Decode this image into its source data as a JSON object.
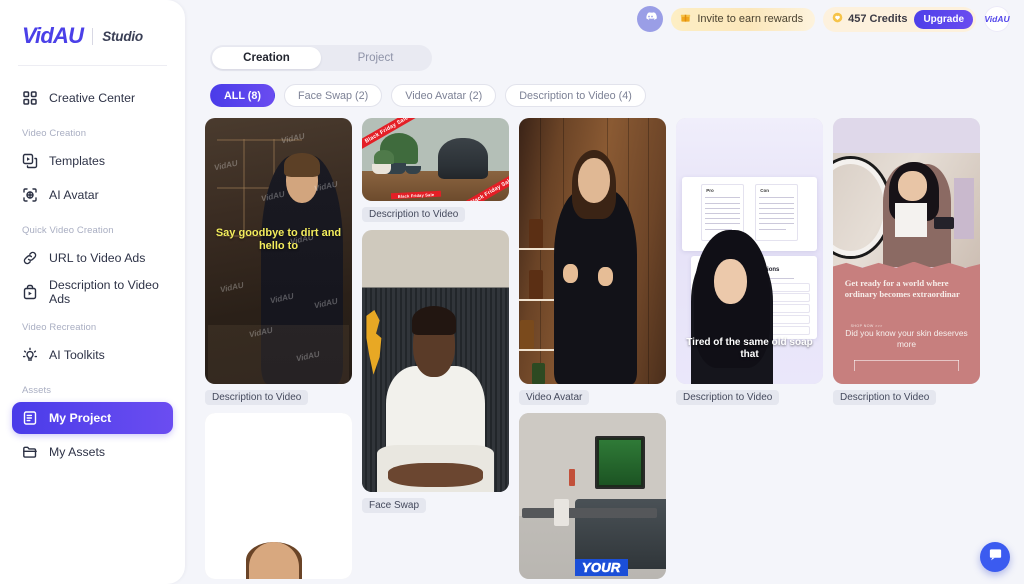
{
  "brand": {
    "name": "VidAU",
    "sub": "Studio"
  },
  "sidebar": {
    "top_items": [
      {
        "label": "Creative Center",
        "icon": "grid-icon"
      }
    ],
    "groups": [
      {
        "label": "Video Creation",
        "items": [
          {
            "label": "Templates",
            "icon": "templates-icon"
          },
          {
            "label": "AI Avatar",
            "icon": "ai-avatar-icon"
          }
        ]
      },
      {
        "label": "Quick Video Creation",
        "items": [
          {
            "label": "URL to Video Ads",
            "icon": "link-icon"
          },
          {
            "label": "Description to Video Ads",
            "icon": "description-icon"
          }
        ]
      },
      {
        "label": "Video Recreation",
        "items": [
          {
            "label": "AI Toolkits",
            "icon": "lightbulb-icon"
          }
        ]
      },
      {
        "label": "Assets",
        "items": [
          {
            "label": "My Project",
            "icon": "project-icon",
            "active": true
          },
          {
            "label": "My Assets",
            "icon": "folder-icon"
          }
        ]
      }
    ]
  },
  "header": {
    "discord_icon": "discord-icon",
    "invite_label": "Invite to earn rewards",
    "invite_icon": "gift-icon",
    "credits_label": "457 Credits",
    "credits_icon": "heart-coin-icon",
    "upgrade_label": "Upgrade",
    "corner_logo": "VidAU"
  },
  "tabs": [
    {
      "label": "Creation",
      "selected": true
    },
    {
      "label": "Project",
      "selected": false
    }
  ],
  "filters": [
    {
      "label": "ALL (8)",
      "selected": true
    },
    {
      "label": "Face Swap (2)",
      "selected": false
    },
    {
      "label": "Video Avatar (2)",
      "selected": false
    },
    {
      "label": "Description to Video (4)",
      "selected": false
    }
  ],
  "colors": {
    "accent": "#4a3ce9",
    "accent_end": "#6a4cf0",
    "page_bg": "#f4f5fa",
    "panel_bg": "#ffffff",
    "chip_bg": "#e5e7ef",
    "credit_pill": "#fdf1dd",
    "invite_pill": "#fbe7bb",
    "chat_blue": "#3b5bf0"
  },
  "cards": {
    "c1": {
      "label": "Description to Video",
      "caption": "Say goodbye to dirt and hello to",
      "watermark": "VidAU"
    },
    "c2": {
      "label": "Description to Video",
      "ribbon": "Black Friday Sale"
    },
    "c3": {
      "label": "Face Swap"
    },
    "c4": {
      "label": "Video Avatar"
    },
    "c5": {
      "label": "Description to Video",
      "caption": "Tired of the same old soap that",
      "faq_title": "Frequently Asked Questions",
      "col_a": "Pro",
      "col_b": "Con"
    },
    "c6": {
      "label": "Description to Video",
      "headline": "Get ready for a world where ordinary becomes extraordinar",
      "sub": "Did you know your skin deserves more",
      "shopnow": "SHOP NOW >>>"
    },
    "c8": {
      "caption": "YOUR"
    }
  },
  "chat": {
    "icon": "chat-bubble-icon"
  }
}
